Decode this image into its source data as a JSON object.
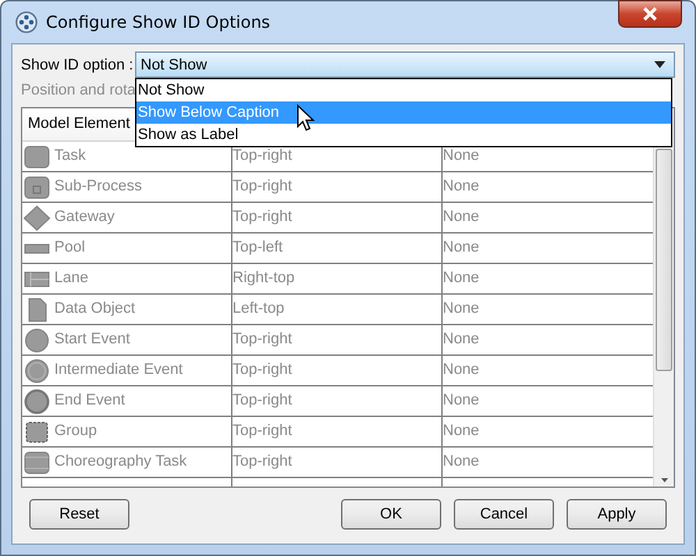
{
  "window": {
    "title": "Configure Show ID Options"
  },
  "show_id_option": {
    "label": "Show ID option :",
    "value": "Not Show",
    "expanded": true,
    "options": [
      {
        "label": "Not Show",
        "highlighted": false
      },
      {
        "label": "Show Below Caption",
        "highlighted": true
      },
      {
        "label": "Show as Label",
        "highlighted": false
      }
    ]
  },
  "position_label": "Position and rota",
  "table": {
    "columns": [
      "Model Element"
    ],
    "rows": [
      {
        "kind": "task",
        "element": "Task",
        "position": "Top-right",
        "rotation": "None"
      },
      {
        "kind": "subprocess",
        "element": "Sub-Process",
        "position": "Top-right",
        "rotation": "None"
      },
      {
        "kind": "gateway",
        "element": "Gateway",
        "position": "Top-right",
        "rotation": "None"
      },
      {
        "kind": "pool",
        "element": "Pool",
        "position": "Top-left",
        "rotation": "None"
      },
      {
        "kind": "lane",
        "element": "Lane",
        "position": "Right-top",
        "rotation": "None"
      },
      {
        "kind": "data-object",
        "element": "Data Object",
        "position": "Left-top",
        "rotation": "None"
      },
      {
        "kind": "start-event",
        "element": "Start Event",
        "position": "Top-right",
        "rotation": "None"
      },
      {
        "kind": "intermediate-event",
        "element": "Intermediate Event",
        "position": "Top-right",
        "rotation": "None"
      },
      {
        "kind": "end-event",
        "element": "End Event",
        "position": "Top-right",
        "rotation": "None"
      },
      {
        "kind": "group",
        "element": "Group",
        "position": "Top-right",
        "rotation": "None"
      },
      {
        "kind": "choreography-task",
        "element": "Choreography Task",
        "position": "Top-right",
        "rotation": "None"
      }
    ],
    "disabled": true
  },
  "buttons": {
    "left": [
      "Reset"
    ],
    "right": [
      "OK",
      "Cancel",
      "Apply"
    ]
  }
}
